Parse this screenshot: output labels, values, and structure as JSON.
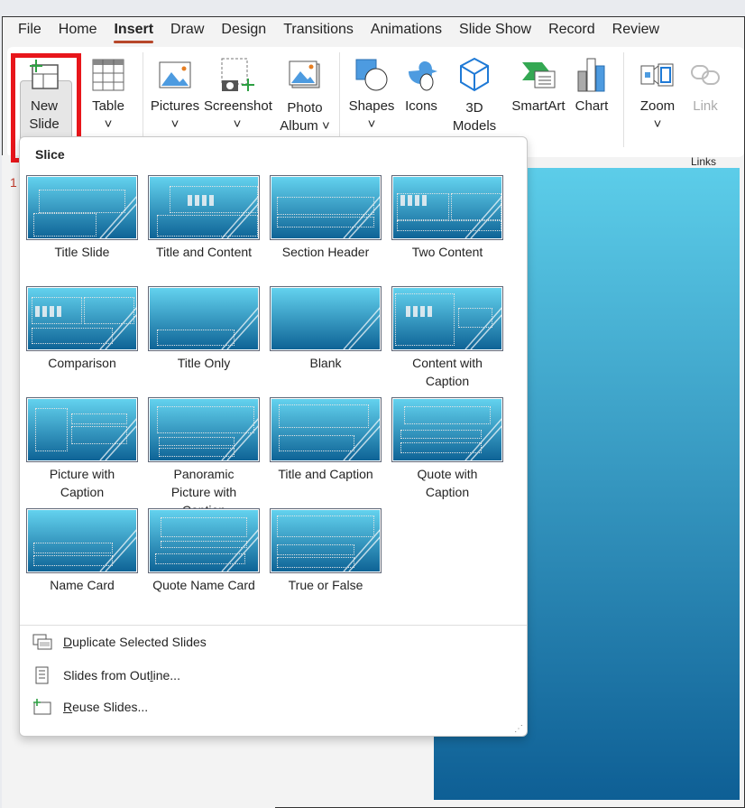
{
  "tabs": [
    "File",
    "Home",
    "Insert",
    "Draw",
    "Design",
    "Transitions",
    "Animations",
    "Slide Show",
    "Record",
    "Review"
  ],
  "active_tab": "Insert",
  "ribbon": {
    "new_slide": [
      "New",
      "Slide ˅"
    ],
    "table": [
      "Table",
      "˅"
    ],
    "pictures": [
      "Pictures",
      "˅"
    ],
    "screenshot": [
      "Screenshot",
      "˅"
    ],
    "photo_album": [
      "Photo",
      "Album ˅"
    ],
    "shapes": [
      "Shapes",
      "˅"
    ],
    "icons": [
      "Icons"
    ],
    "models": [
      "3D",
      "Models ˅"
    ],
    "smartart": [
      "SmartArt"
    ],
    "chart": [
      "Chart"
    ],
    "zoom": [
      "Zoom",
      "˅"
    ],
    "link": [
      "Link"
    ],
    "links_group": "Links"
  },
  "thumbnail_number": "1",
  "menu": {
    "title": "Slice",
    "layouts": [
      {
        "label": "Title Slide"
      },
      {
        "label": "Title and Content"
      },
      {
        "label": "Section Header"
      },
      {
        "label": "Two Content"
      },
      {
        "label": "Comparison"
      },
      {
        "label": "Title Only"
      },
      {
        "label": "Blank"
      },
      {
        "label": "Content with Caption"
      },
      {
        "label": "Picture with Caption"
      },
      {
        "label": "Panoramic Picture with Caption"
      },
      {
        "label": "Title and Caption"
      },
      {
        "label": "Quote with Caption"
      },
      {
        "label": "Name Card"
      },
      {
        "label": "Quote Name Card"
      },
      {
        "label": "True or False"
      }
    ],
    "actions": [
      {
        "pre": "",
        "u": "D",
        "post": "uplicate Selected Slides",
        "icon": "duplicate-slides-icon"
      },
      {
        "pre": "Slides from Out",
        "u": "l",
        "post": "ine...",
        "icon": "outline-icon"
      },
      {
        "pre": "",
        "u": "R",
        "post": "euse Slides...",
        "icon": "reuse-slides-icon"
      }
    ]
  },
  "colors": {
    "accent": "#b7472a",
    "highlight": "#e8161b",
    "slide_top": "#5ccde9",
    "slide_bottom": "#0e5f95"
  }
}
